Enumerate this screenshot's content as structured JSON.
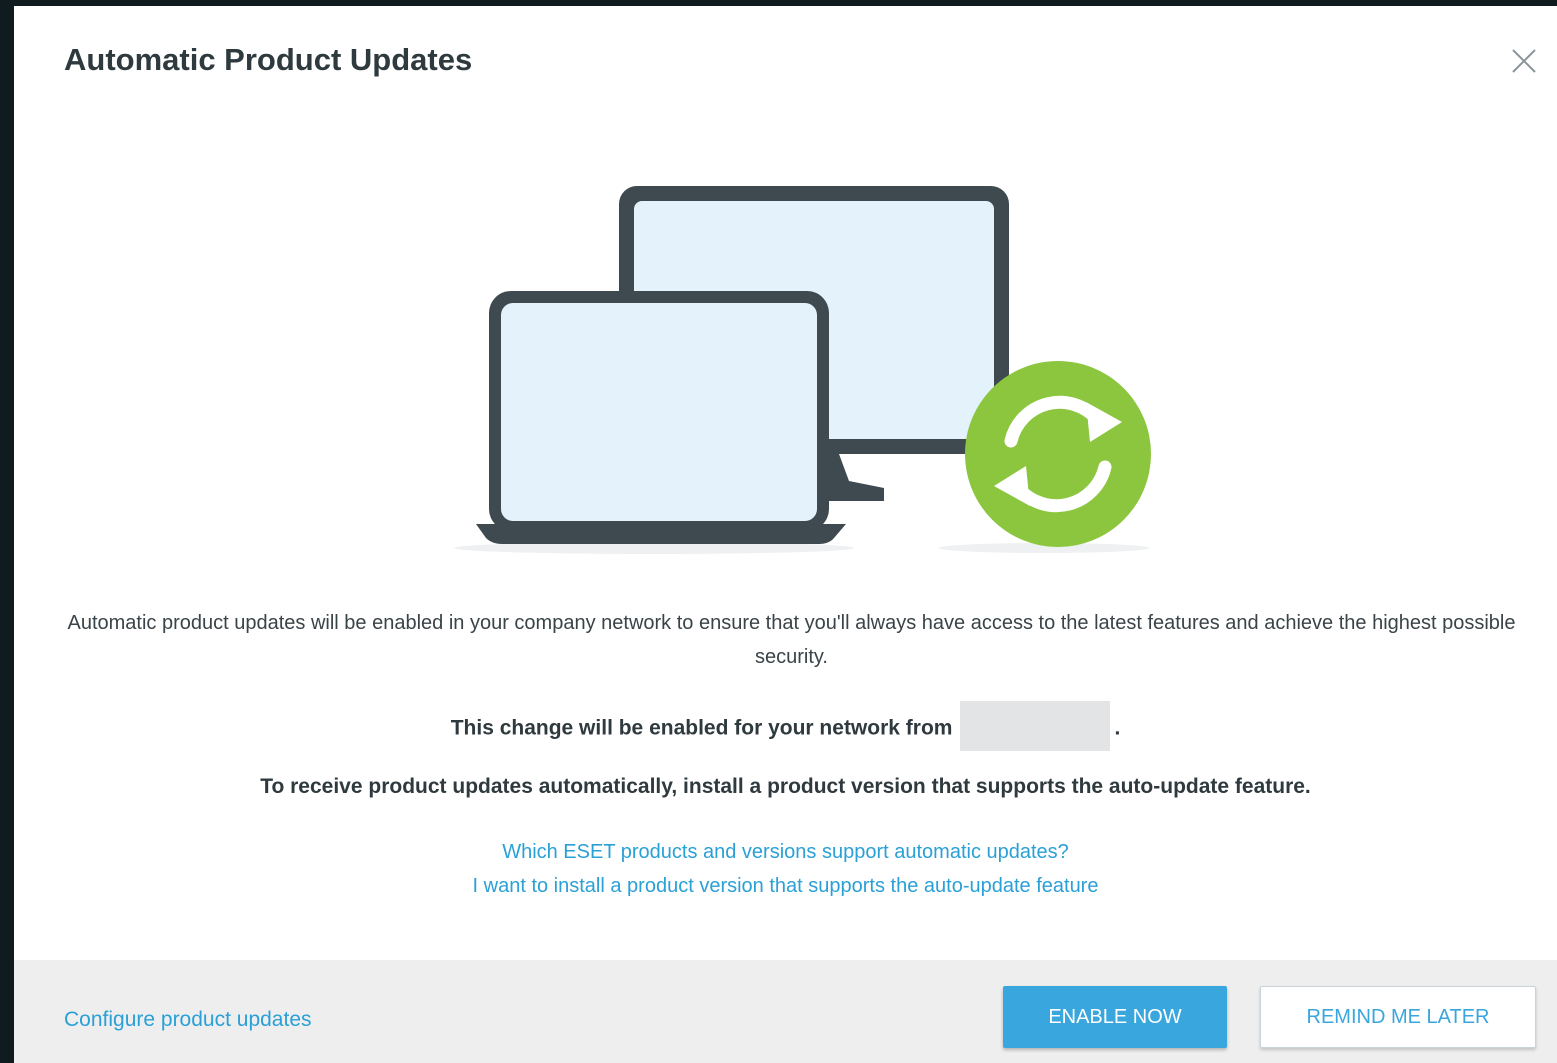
{
  "dialog": {
    "title": "Automatic Product Updates",
    "description": "Automatic product updates will be enabled in your company network to ensure that you'll always have access to the latest features and achieve the highest possible security.",
    "change_prefix": "This change will be enabled for your network from",
    "change_suffix": ".",
    "receive_text": "To receive product updates automatically, install a product version that supports the auto-update feature.",
    "link_supported": "Which ESET products and versions support automatic updates?",
    "link_install": "I want to install a product version that supports the auto-update feature"
  },
  "footer": {
    "configure_link": "Configure product updates",
    "enable_label": "ENABLE NOW",
    "remind_label": "REMIND ME LATER"
  },
  "colors": {
    "accent": "#39a6dd",
    "link": "#2aa0d6",
    "sync_badge": "#8cc63f",
    "device_frame": "#3e4a50",
    "screen": "#e3f2fb"
  }
}
